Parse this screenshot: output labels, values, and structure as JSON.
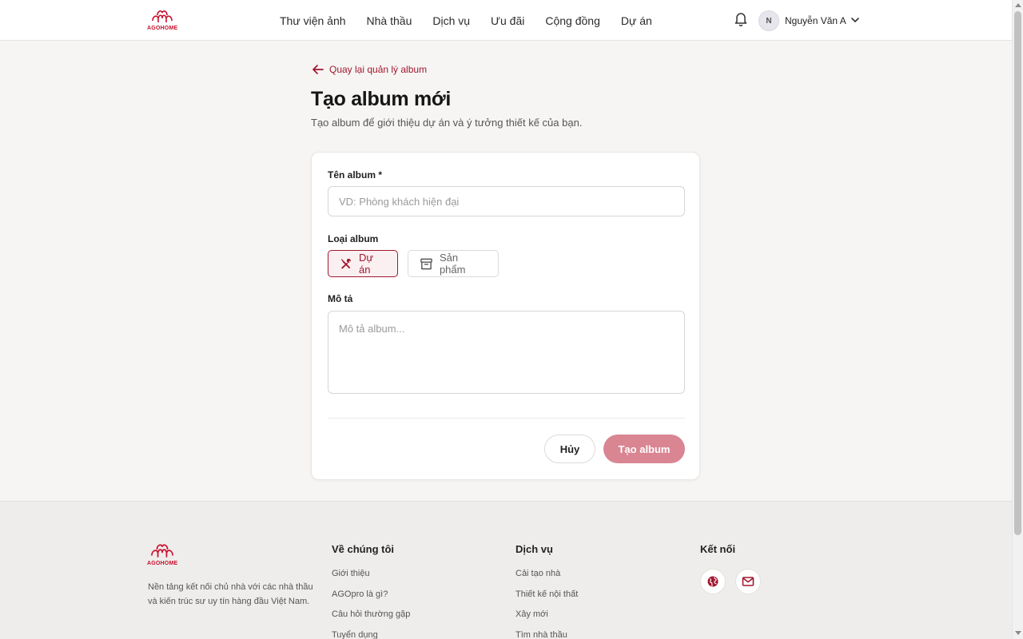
{
  "brand": {
    "name": "AGOHOME",
    "color": "#c8102e"
  },
  "header": {
    "nav": [
      "Thư viện ảnh",
      "Nhà thầu",
      "Dịch vụ",
      "Ưu đãi",
      "Cộng đồng",
      "Dự án"
    ],
    "user": {
      "initial": "N",
      "name": "Nguyễn Văn A"
    },
    "icons": [
      "bell-icon",
      "chevron-down-icon"
    ]
  },
  "page": {
    "back_label": "Quay lại quản lý album",
    "title": "Tạo album mới",
    "subtitle": "Tạo album để giới thiệu dự án và ý tưởng thiết kế của bạn."
  },
  "form": {
    "name_label": "Tên album *",
    "name_value": "",
    "name_placeholder": "VD: Phòng khách hiện đại",
    "type_label": "Loại album",
    "types": [
      {
        "label": "Dự án",
        "icon": "tools-icon",
        "selected": true
      },
      {
        "label": "Sản phẩm",
        "icon": "archive-icon",
        "selected": false
      }
    ],
    "desc_label": "Mô tả",
    "desc_value": "",
    "desc_placeholder": "Mô tả album...",
    "cancel_label": "Hủy",
    "submit_label": "Tạo album",
    "accent_color": "#a0172f",
    "submit_color": "#d98592"
  },
  "footer": {
    "description": "Nền tảng kết nối chủ nhà với các nhà thầu và kiến trúc sư uy tín hàng đầu Việt Nam.",
    "about": {
      "title": "Về chúng tôi",
      "links": [
        "Giới thiệu",
        "AGOpro là gì?",
        "Câu hỏi thường gặp",
        "Tuyển dụng"
      ]
    },
    "services": {
      "title": "Dịch vụ",
      "links": [
        "Cải tạo nhà",
        "Thiết kế nội thất",
        "Xây mới",
        "Tìm nhà thầu"
      ]
    },
    "connect": {
      "title": "Kết nối",
      "icons": [
        "globe-icon",
        "mail-icon"
      ]
    }
  }
}
